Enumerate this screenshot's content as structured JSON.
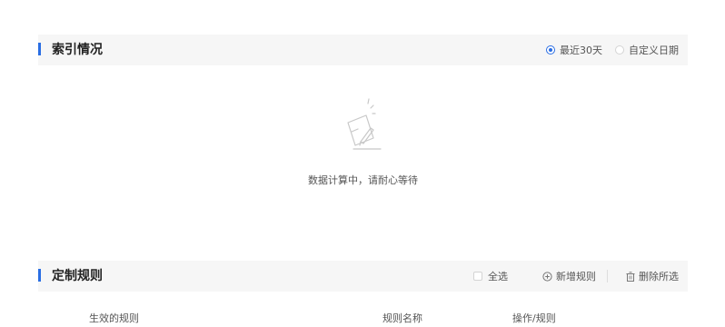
{
  "index_section": {
    "title": "索引情况",
    "range_options": [
      {
        "label": "最近30天",
        "selected": true
      },
      {
        "label": "自定义日期",
        "selected": false
      }
    ],
    "empty_message": "数据计算中，请耐心等待"
  },
  "rules_section": {
    "title": "定制规则",
    "select_all_label": "全选",
    "add_rule_label": "新增规则",
    "delete_selected_label": "删除所选",
    "columns": [
      "生效的规则",
      "规则名称",
      "操作/规则"
    ]
  },
  "colors": {
    "accent": "#2a6ee3",
    "header_bg": "#f6f6f6"
  },
  "icons": {
    "empty": "empty-notebook-icon",
    "add": "plus-circle-icon",
    "delete": "trash-icon"
  }
}
